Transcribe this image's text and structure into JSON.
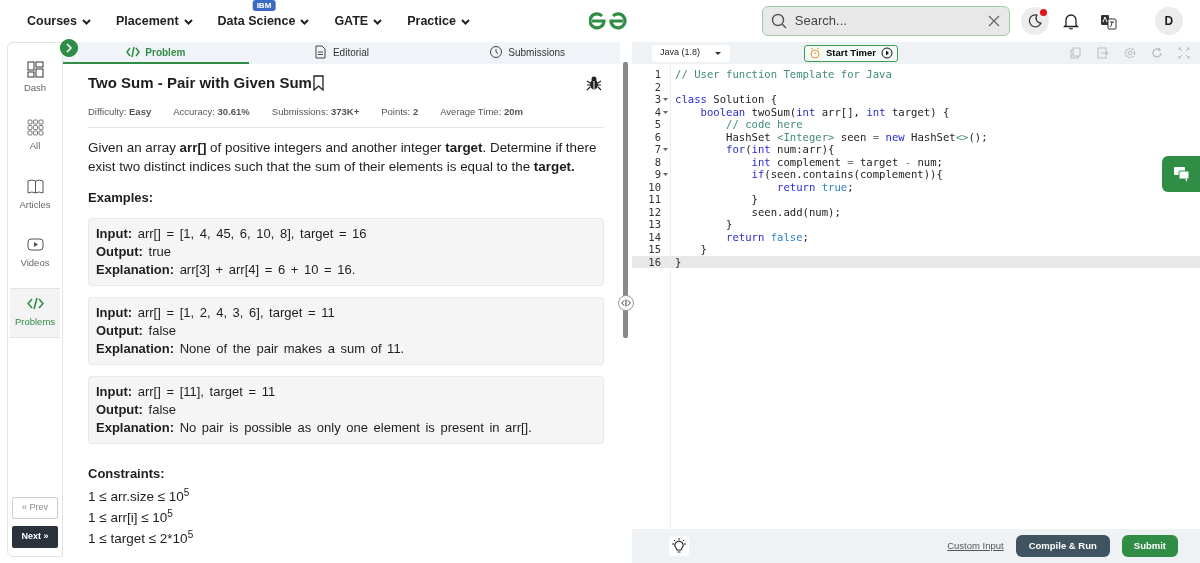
{
  "nav": {
    "items": [
      {
        "label": "Courses"
      },
      {
        "label": "Placement"
      },
      {
        "label": "Data Science",
        "badge": "IBM"
      },
      {
        "label": "GATE"
      },
      {
        "label": "Practice"
      }
    ],
    "search": {
      "placeholder": "Search..."
    },
    "theme_notification": true,
    "avatar": "D"
  },
  "sidebar": {
    "items": [
      {
        "label": "Dash",
        "selected": false
      },
      {
        "label": "All",
        "selected": false
      },
      {
        "label": "Articles",
        "selected": false
      },
      {
        "label": "Videos",
        "selected": false
      },
      {
        "label": "Problems",
        "selected": true
      }
    ],
    "prev": {
      "label": "« Prev",
      "disabled": true
    },
    "next": {
      "label": "Next »",
      "disabled": false
    }
  },
  "tabs": [
    {
      "label": "Problem",
      "selected": true
    },
    {
      "label": "Editorial",
      "selected": false
    },
    {
      "label": "Submissions",
      "selected": false
    }
  ],
  "problem": {
    "title": "Two Sum - Pair with Given Sum",
    "bookmarked": false,
    "meta": [
      "Difficulty: **Easy**",
      "Accuracy: **30.61%**",
      "Submissions: **373K+**",
      "Points: **2**",
      "Average Time: **20m**"
    ],
    "statement": "Given an array **arr[]** of positive integers and another integer **target**. Determine if there exist two distinct indices such that the sum of their elements is equal to the **target.**",
    "examples_heading": "Examples:",
    "examples": [
      {
        "lines": [
          "**Input:** arr[] = [1, 4, 45, 6, 10, 8], target = 16",
          "**Output:** true",
          "**Explanation:** arr[3] + arr[4] = 6 + 10 = 16."
        ]
      },
      {
        "lines": [
          "**Input:** arr[] = [1, 2, 4, 3, 6], target = 11",
          "**Output:** false",
          "**Explanation:** None of the pair makes a sum of 11."
        ]
      },
      {
        "lines": [
          "**Input:** arr[] = [11], target = 11",
          "**Output:** false",
          "**Explanation:** No pair is possible as only one element is present in arr[]."
        ]
      }
    ],
    "constraints_heading": "Constraints:",
    "constraints": [
      "1 ≤ arr.size ≤ 10$^{5}$",
      "1 ≤ arr[i] ≤ 10$^{5}$",
      "1 ≤ target ≤ 2*10$^{5}$"
    ]
  },
  "editor": {
    "language": "Java (1.8)",
    "timer": "Start Timer",
    "lines": [
      {
        "no": "1",
        "fold": false,
        "active": false,
        "tokens": [
          {
            "t": "// User function Template for Java",
            "kind": "comment"
          }
        ]
      },
      {
        "no": "2",
        "fold": false,
        "active": false
      },
      {
        "no": "3",
        "fold": true,
        "active": false,
        "tokens": [
          {
            "t": "class",
            "kind": "keyword"
          },
          {
            "t": " Solution {",
            "kind": "plain"
          }
        ]
      },
      {
        "no": "4",
        "fold": true,
        "active": false,
        "tokens": [
          {
            "t": "    boolean",
            "kind": "keyword"
          },
          {
            "t": " twoSum(",
            "kind": "plain"
          },
          {
            "t": "int",
            "kind": "keyword"
          },
          {
            "t": " arr[], ",
            "kind": "plain"
          },
          {
            "t": "int",
            "kind": "keyword"
          },
          {
            "t": " target) {",
            "kind": "plain"
          }
        ]
      },
      {
        "no": "5",
        "fold": false,
        "active": false,
        "tokens": [
          {
            "t": "        // code here",
            "kind": "comment"
          }
        ]
      },
      {
        "no": "6",
        "fold": false,
        "active": false,
        "tokens": [
          {
            "t": "        HashSet ",
            "kind": "plain"
          },
          {
            "t": "<Integer>",
            "kind": "comment"
          },
          {
            "t": " seen ",
            "kind": "plain"
          },
          {
            "t": "=",
            "kind": "operator"
          },
          {
            "t": " new",
            "kind": "keyword"
          },
          {
            "t": " HashSet",
            "kind": "plain"
          },
          {
            "t": "<>",
            "kind": "comment"
          },
          {
            "t": "();",
            "kind": "plain"
          }
        ]
      },
      {
        "no": "7",
        "fold": true,
        "active": false,
        "tokens": [
          {
            "t": "        for",
            "kind": "keyword"
          },
          {
            "t": "(",
            "kind": "plain"
          },
          {
            "t": "int",
            "kind": "keyword"
          },
          {
            "t": " num:arr){",
            "kind": "plain"
          }
        ]
      },
      {
        "no": "8",
        "fold": false,
        "active": false,
        "tokens": [
          {
            "t": "            int",
            "kind": "keyword"
          },
          {
            "t": " complement ",
            "kind": "plain"
          },
          {
            "t": "=",
            "kind": "operator"
          },
          {
            "t": " target ",
            "kind": "plain"
          },
          {
            "t": "-",
            "kind": "operator"
          },
          {
            "t": " num;",
            "kind": "plain"
          }
        ]
      },
      {
        "no": "9",
        "fold": true,
        "active": false,
        "tokens": [
          {
            "t": "            if",
            "kind": "keyword"
          },
          {
            "t": "(seen.contains(complement)){",
            "kind": "plain"
          }
        ]
      },
      {
        "no": "10",
        "fold": false,
        "active": false,
        "tokens": [
          {
            "t": "                return",
            "kind": "keyword"
          },
          {
            "t": " true",
            "kind": "literal"
          },
          {
            "t": ";",
            "kind": "plain"
          }
        ]
      },
      {
        "no": "11",
        "fold": false,
        "active": false,
        "tokens": [
          {
            "t": "            }",
            "kind": "plain"
          }
        ]
      },
      {
        "no": "12",
        "fold": false,
        "active": false,
        "tokens": [
          {
            "t": "            seen.add(num);",
            "kind": "plain"
          }
        ]
      },
      {
        "no": "13",
        "fold": false,
        "active": false,
        "tokens": [
          {
            "t": "        }",
            "kind": "plain"
          }
        ]
      },
      {
        "no": "14",
        "fold": false,
        "active": false,
        "tokens": [
          {
            "t": "        return",
            "kind": "keyword"
          },
          {
            "t": " false",
            "kind": "literal"
          },
          {
            "t": ";",
            "kind": "plain"
          }
        ]
      },
      {
        "no": "15",
        "fold": false,
        "active": false,
        "tokens": [
          {
            "t": "    }",
            "kind": "plain"
          }
        ]
      },
      {
        "no": "16",
        "fold": false,
        "active": true,
        "tokens": [
          {
            "t": "}",
            "kind": "plain"
          }
        ]
      }
    ],
    "custom_input": "Custom Input",
    "compile": "Compile & Run",
    "submit": "Submit"
  }
}
